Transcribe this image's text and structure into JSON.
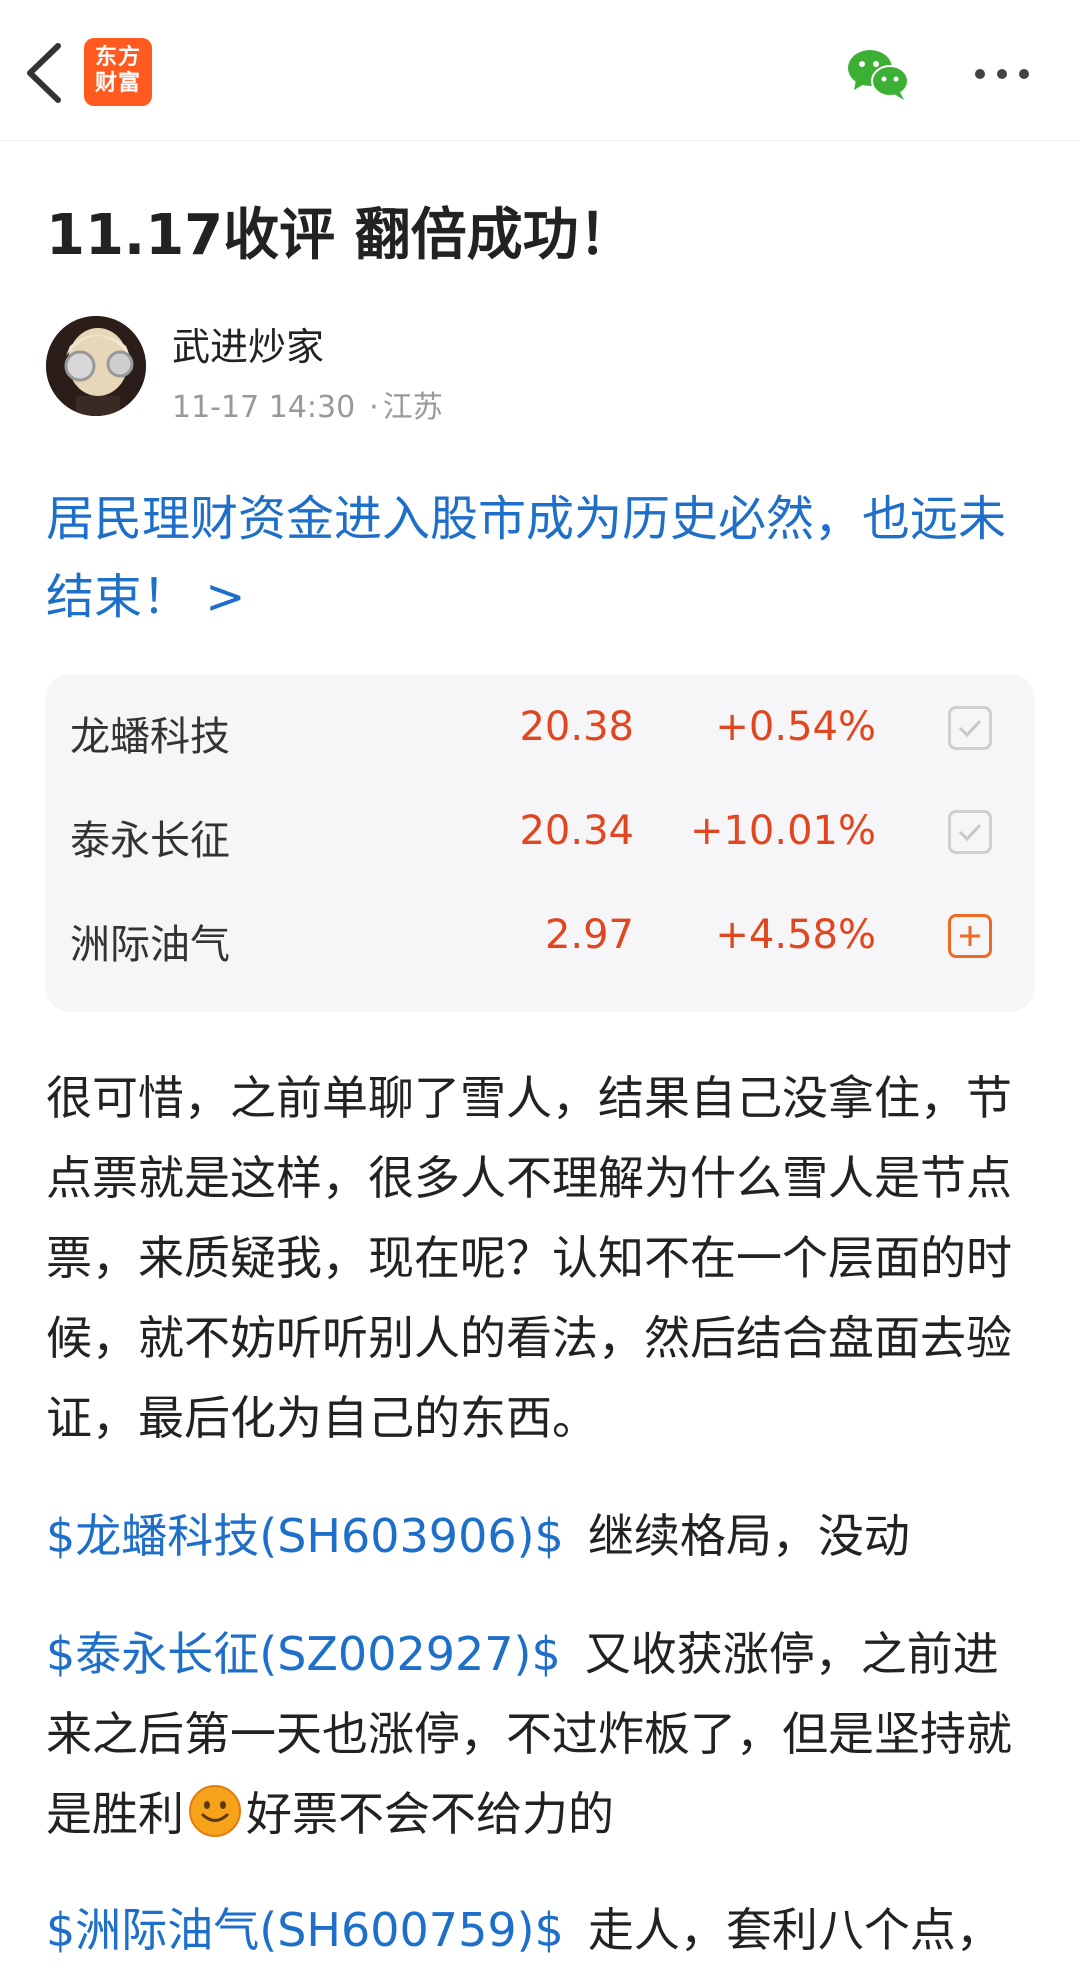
{
  "header": {
    "logo_text_line1": "东方",
    "logo_text_line2": "财富",
    "back_icon": "chevron-left-icon",
    "share_icon": "wechat-icon",
    "more_icon": "more-horizontal-icon",
    "brand_color": "#ff5a1f"
  },
  "article": {
    "title": "11.17收评 翻倍成功！",
    "author": "武进炒家",
    "time": "11-17 14:30",
    "location": "江苏",
    "headline_link": "居民理财资金进入股市成为历史必然，也远未结束！ >"
  },
  "stocks": [
    {
      "name": "龙蟠科技",
      "price": "20.38",
      "change": "+0.54%",
      "status": "added",
      "icon": "checkbox-checked-icon"
    },
    {
      "name": "泰永长征",
      "price": "20.34",
      "change": "+10.01%",
      "status": "added",
      "icon": "checkbox-checked-icon"
    },
    {
      "name": "洲际油气",
      "price": "2.97",
      "change": "+4.58%",
      "status": "add",
      "icon": "add-square-icon"
    }
  ],
  "content": {
    "p1": "很可惜，之前单聊了雪人，结果自己没拿住，节点票就是这样，很多人不理解为什么雪人是节点票，来质疑我，现在呢？认知不在一个层面的时候，就不妨听听别人的看法，然后结合盘面去验证，最后化为自己的东西。",
    "p2_tag": "$龙蟠科技(SH603906)$",
    "p2_text": "继续格局，没动",
    "p3_tag": "$泰永长征(SZ002927)$",
    "p3_text_a": "又收获涨停，之前进来之后第一天也涨停，不过炸板了，但是坚持就是胜利",
    "p3_text_b": "好票不会不给力的",
    "p4_tag": "$洲际油气(SH600759)$",
    "p4_text": "走人，套利八个点，"
  },
  "colors": {
    "link": "#1e6fc9",
    "up": "#e0461f",
    "wechat_green": "#3cb034"
  }
}
